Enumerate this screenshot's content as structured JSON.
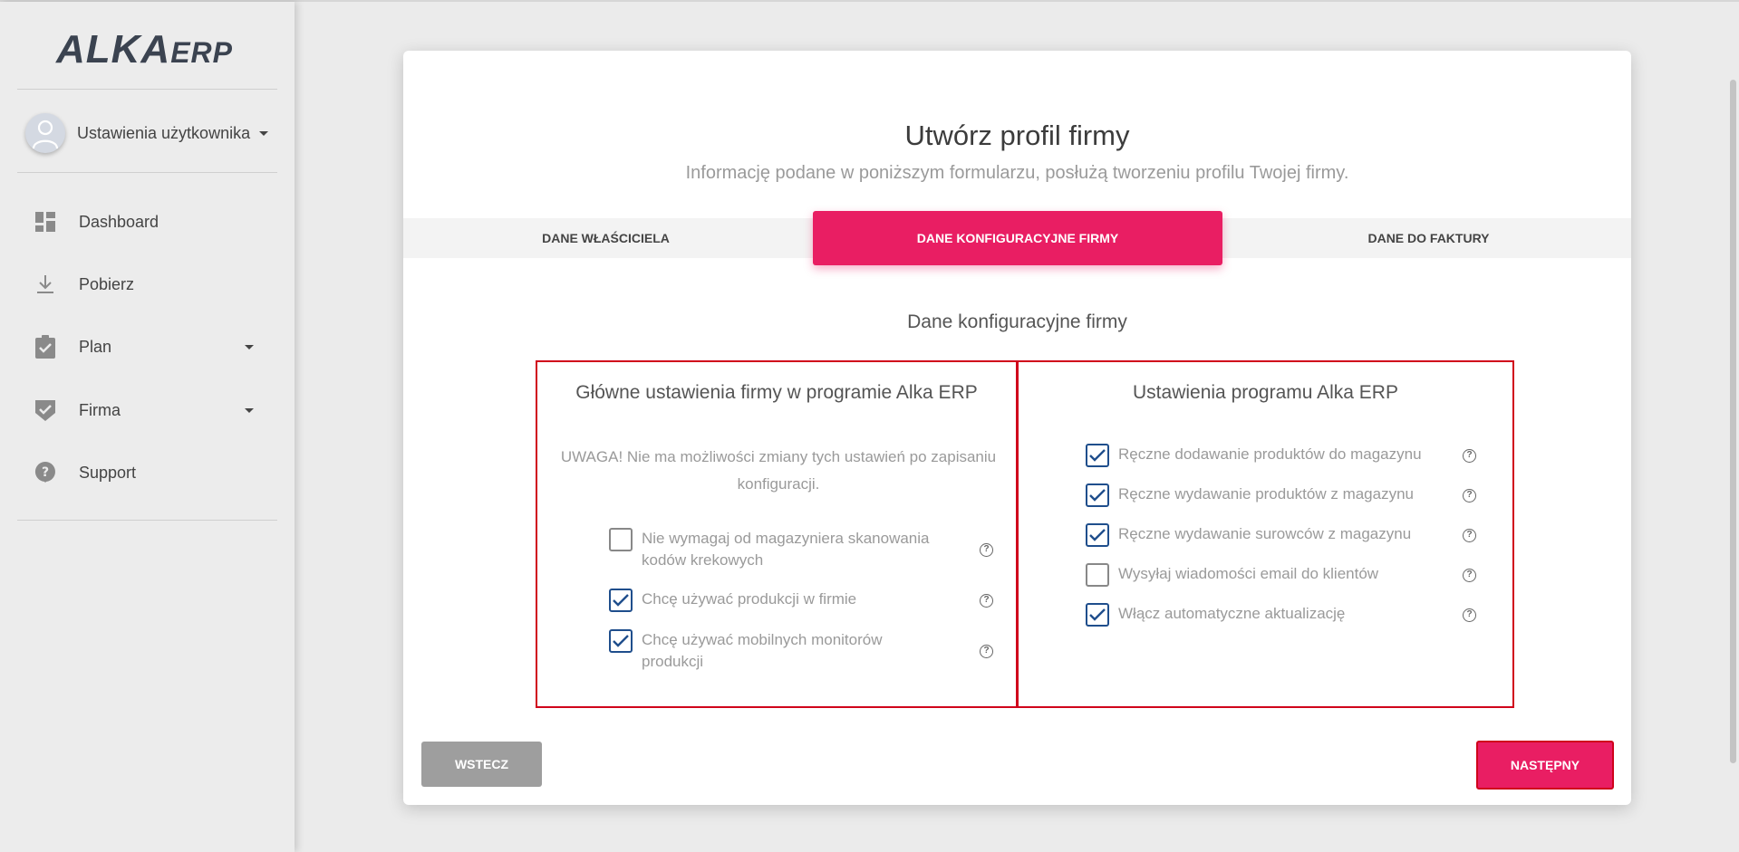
{
  "app": {
    "logo_big": "ALKA",
    "logo_small": "ERP"
  },
  "sidebar": {
    "user_label": "Ustawienia użytkownika",
    "items": [
      {
        "label": "Dashboard",
        "icon": "dashboard-icon"
      },
      {
        "label": "Pobierz",
        "icon": "download-icon"
      },
      {
        "label": "Plan",
        "icon": "clipboard-check-icon"
      },
      {
        "label": "Firma",
        "icon": "shield-check-icon"
      },
      {
        "label": "Support",
        "icon": "help-icon"
      }
    ]
  },
  "page": {
    "title": "Utwórz profil firmy",
    "subtitle": "Informację podane w poniższym formularzu, posłużą tworzeniu profilu Twojej firmy.",
    "tabs": [
      {
        "label": "DANE WŁAŚCICIELA",
        "active": false
      },
      {
        "label": "DANE KONFIGURACYJNE FIRMY",
        "active": true
      },
      {
        "label": "DANE DO FAKTURY",
        "active": false
      }
    ],
    "section_title": "Dane konfiguracyjne firmy"
  },
  "left_panel": {
    "title": "Główne ustawienia firmy w programie Alka ERP",
    "warning": "UWAGA! Nie ma możliwości zmiany tych ustawień po zapisaniu konfiguracji.",
    "options": [
      {
        "label": "Nie wymagaj od magazyniera skanowania kodów krekowych",
        "checked": false
      },
      {
        "label": "Chcę używać produkcji w firmie",
        "checked": true
      },
      {
        "label": "Chcę używać mobilnych monitorów produkcji",
        "checked": true
      }
    ]
  },
  "right_panel": {
    "title": "Ustawienia programu Alka ERP",
    "options": [
      {
        "label": "Ręczne dodawanie produktów do magazynu",
        "checked": true
      },
      {
        "label": "Ręczne wydawanie produktów z magazynu",
        "checked": true
      },
      {
        "label": "Ręczne wydawanie surowców z magazynu",
        "checked": true
      },
      {
        "label": "Wysyłaj wiadomości email do klientów",
        "checked": false
      },
      {
        "label": "Włącz automatyczne aktualizację",
        "checked": true
      }
    ]
  },
  "buttons": {
    "back": "WSTECZ",
    "next": "NASTĘPNY"
  },
  "help_glyph": "?",
  "colors": {
    "accent": "#e91e63",
    "highlight_border": "#d0021b",
    "checkbox_checked": "#1f4e8c"
  }
}
